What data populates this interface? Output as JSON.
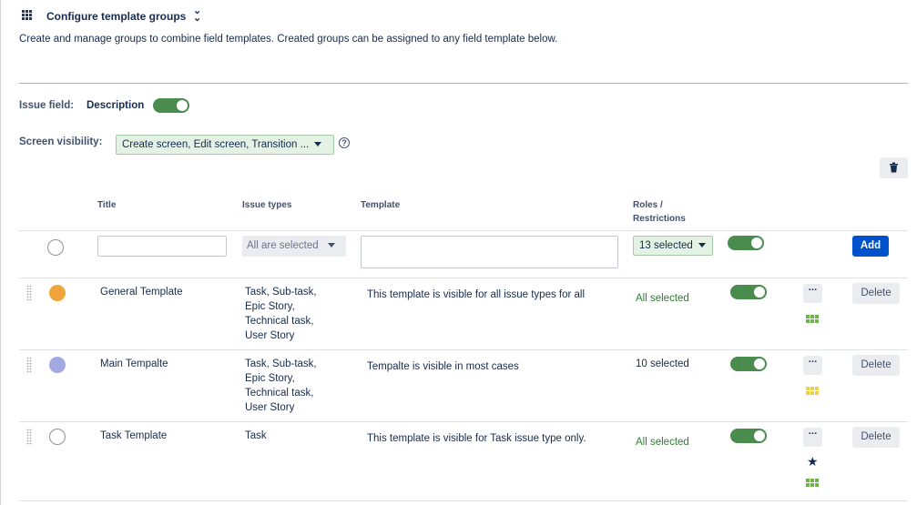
{
  "header": {
    "title": "Configure template groups",
    "description": "Create and manage groups to combine field templates. Created groups can be assigned to any field template below."
  },
  "issue_field": {
    "label": "Issue field:",
    "value": "Description",
    "toggle_on": true
  },
  "screen_visibility": {
    "label": "Screen visibility:",
    "value": "Create screen, Edit screen, Transition ..."
  },
  "table": {
    "headers": {
      "title": "Title",
      "issue_types": "Issue types",
      "template": "Template",
      "roles_1": "Roles /",
      "roles_2": "Restrictions"
    },
    "new_row": {
      "issue_types": "All are selected",
      "roles": "13 selected",
      "add_label": "Add"
    },
    "rows": [
      {
        "color": "#f0a53c",
        "title": "General Template",
        "issue_types": [
          "Task, Sub-task,",
          "Epic Story,",
          "Technical task,",
          "User Story"
        ],
        "template": "This template is visible for all issue types for all",
        "roles": "All selected",
        "roles_green": true,
        "grid_color": "#6bb545",
        "starred": false,
        "delete_label": "Delete"
      },
      {
        "color": "#a2a9e0",
        "title": "Main Tempalte",
        "issue_types": [
          "Task, Sub-task,",
          "Epic Story,",
          "Technical task,",
          "User Story"
        ],
        "template": "Tempalte is visible in most cases",
        "roles": "10 selected",
        "roles_green": false,
        "grid_color": "#f2cf4a",
        "starred": false,
        "delete_label": "Delete"
      },
      {
        "color": "#ffffff",
        "title": "Task Template",
        "issue_types": [
          "Task"
        ],
        "template": "This template is visible for Task issue type only.",
        "roles": "All selected",
        "roles_green": true,
        "grid_color": "#6bb545",
        "starred": true,
        "delete_label": "Delete"
      }
    ]
  },
  "icons": {
    "header": "grid-icon",
    "collapse": "double-chevron-down-icon",
    "help": "question-circle-icon",
    "trash": "trash-icon",
    "more": "more-horizontal-icon",
    "star": "star-icon"
  }
}
